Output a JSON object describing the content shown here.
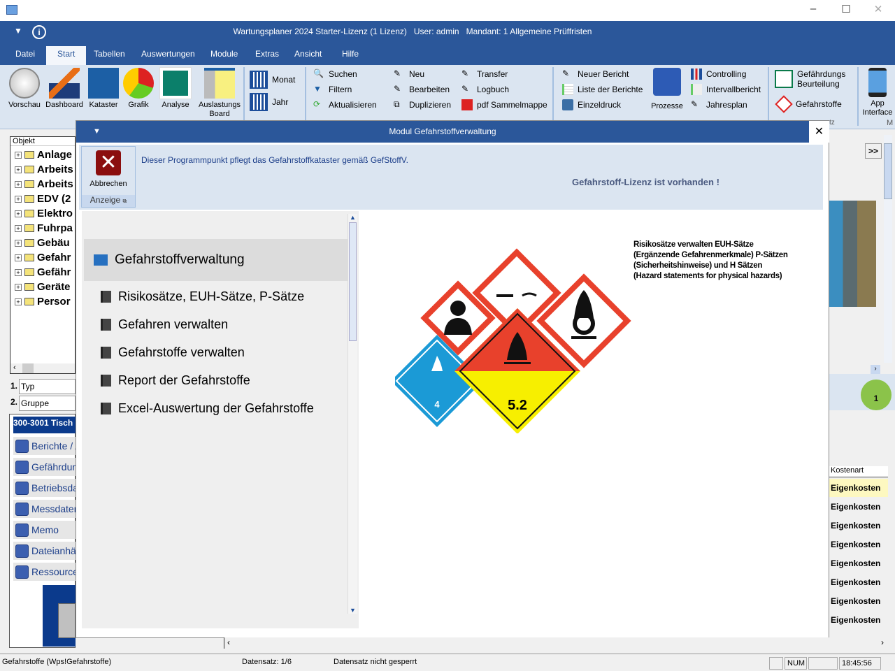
{
  "window": {
    "title": "Wartungsplaner 2024 Starter-Lizenz (1 Lizenz)   User: admin   Mandant: 1 Allgemeine Prüffristen",
    "controls": [
      "minimize",
      "maximize",
      "close"
    ]
  },
  "menu": [
    "Datei",
    "Start",
    "Tabellen",
    "Auswertungen",
    "Module",
    "Extras",
    "Ansicht",
    "Hilfe"
  ],
  "menu_selected": "Start",
  "ribbon": {
    "big": [
      {
        "label": "Vorschau"
      },
      {
        "label": "Dashboard"
      },
      {
        "label": "Kataster"
      },
      {
        "label": "Grafik"
      },
      {
        "label": "Analyse"
      },
      {
        "label": "Auslastungs Board"
      }
    ],
    "period": [
      "Monat",
      "Jahr"
    ],
    "col1": [
      "Suchen",
      "Filtern",
      "Aktualisieren"
    ],
    "col2": [
      "Neu",
      "Bearbeiten",
      "Duplizieren"
    ],
    "col3": [
      "Transfer",
      "Logbuch",
      "pdf Sammelmappe"
    ],
    "col4": [
      "Neuer Bericht",
      "Liste der Berichte",
      "Einzeldruck"
    ],
    "prozesse": "Prozesse",
    "col5": [
      "Controlling",
      "Intervallbericht",
      "Jahresplan"
    ],
    "gbu": "Gefährdungs Beurteilung",
    "gefahrstoffe": "Gefahrstoffe",
    "app": "App Interface",
    "group_partial": "tz",
    "group_partial2": "M"
  },
  "tree": {
    "header": "Objekt",
    "nodes": [
      "Anlage",
      "Arbeits",
      "Arbeits",
      "EDV (2",
      "Elektro",
      "Fuhrpa",
      "Gebäu",
      "Gefahr",
      "Gefähr",
      "Geräte",
      "Persor"
    ]
  },
  "filters": [
    {
      "num": "1.",
      "value": "Typ"
    },
    {
      "num": "2.",
      "value": "Gruppe"
    }
  ],
  "selected_record": "300-3001 Tisch",
  "left_nav": [
    "Berichte / A",
    "Gefährdung",
    "Betriebsda",
    "Messdaten",
    "Memo",
    "Dateianhän",
    "Ressource"
  ],
  "modal": {
    "title": "Modul Gefahrstoffverwaltung",
    "cancel": "Abbrechen",
    "group": "Anzeige",
    "info": "Dieser Programmpunkt pflegt das Gefahrstoffkataster gemäß GefStoffV.",
    "license": "Gefahrstoff-Lizenz ist vorhanden !",
    "section": "Gefahrstoffverwaltung",
    "items": [
      "Risikosätze, EUH-Sätze, P-Sätze",
      "Gefahren verwalten",
      "Gefahrstoffe verwalten",
      "Report der Gefahrstoffe",
      "Excel-Auswertung der Gefahrstoffe"
    ],
    "description": [
      "Risikosätze verwalten  EUH-Sätze",
      "(Ergänzende Gefahrenmerkmale) P-Sätzen",
      "(Sicherheitshinweise) und H Sätzen",
      "(Hazard statements for physical hazards)"
    ],
    "placard_labels": [
      "4",
      "5.2"
    ]
  },
  "right": {
    "more": ">>",
    "col_header": "Kostenart",
    "rows": [
      "Eigenkosten",
      "Eigenkosten",
      "Eigenkosten",
      "Eigenkosten",
      "Eigenkosten",
      "Eigenkosten",
      "Eigenkosten",
      "Eigenkosten"
    ],
    "user_count": "1"
  },
  "status": {
    "left": "Gefahrstoffe (Wps!Gefahrstoffe)",
    "record": "Datensatz: 1/6",
    "lock": "Datensatz nicht gesperrt",
    "num": "NUM",
    "time": "18:45:56"
  },
  "colors": {
    "brand": "#2b579a",
    "ribbon": "#dbe5f1",
    "hazard_red": "#e8412c",
    "hazard_blue": "#1b9ad6",
    "hazard_yellow": "#f7ef00"
  }
}
